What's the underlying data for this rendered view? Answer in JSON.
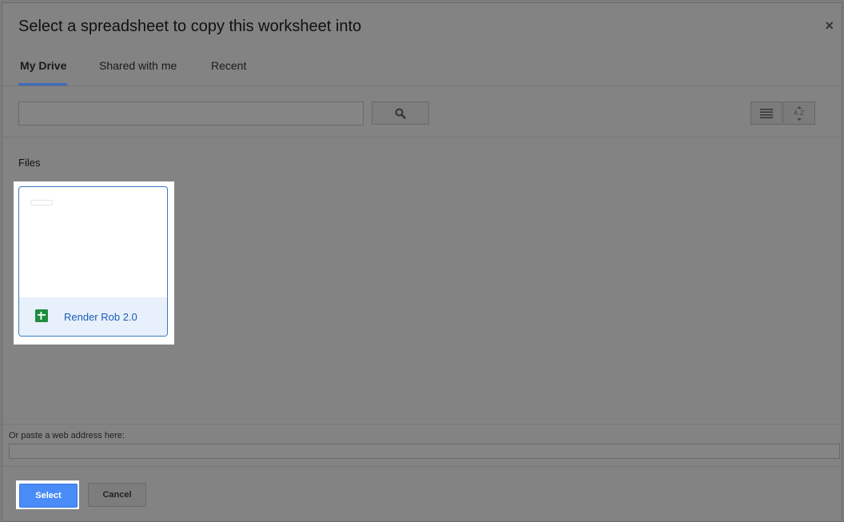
{
  "dialog": {
    "title": "Select a spreadsheet to copy this worksheet into",
    "close_symbol": "×"
  },
  "tabs": [
    {
      "label": "My Drive",
      "active": true
    },
    {
      "label": "Shared with me",
      "active": false
    },
    {
      "label": "Recent",
      "active": false
    }
  ],
  "search": {
    "value": "",
    "button_icon": "search-icon"
  },
  "view_controls": {
    "list_icon": "list-view-icon",
    "sort_icon": "sort-az-icon"
  },
  "files": {
    "section_label": "Files",
    "items": [
      {
        "name": "Render Rob 2.0",
        "icon": "sheets-icon",
        "selected": true
      }
    ]
  },
  "paste": {
    "label": "Or paste a web address here:",
    "value": ""
  },
  "buttons": {
    "select_label": "Select",
    "cancel_label": "Cancel"
  },
  "colors": {
    "accent": "#4a8cf7",
    "link": "#1a5cb8",
    "sheets_green": "#1e8e3e"
  }
}
